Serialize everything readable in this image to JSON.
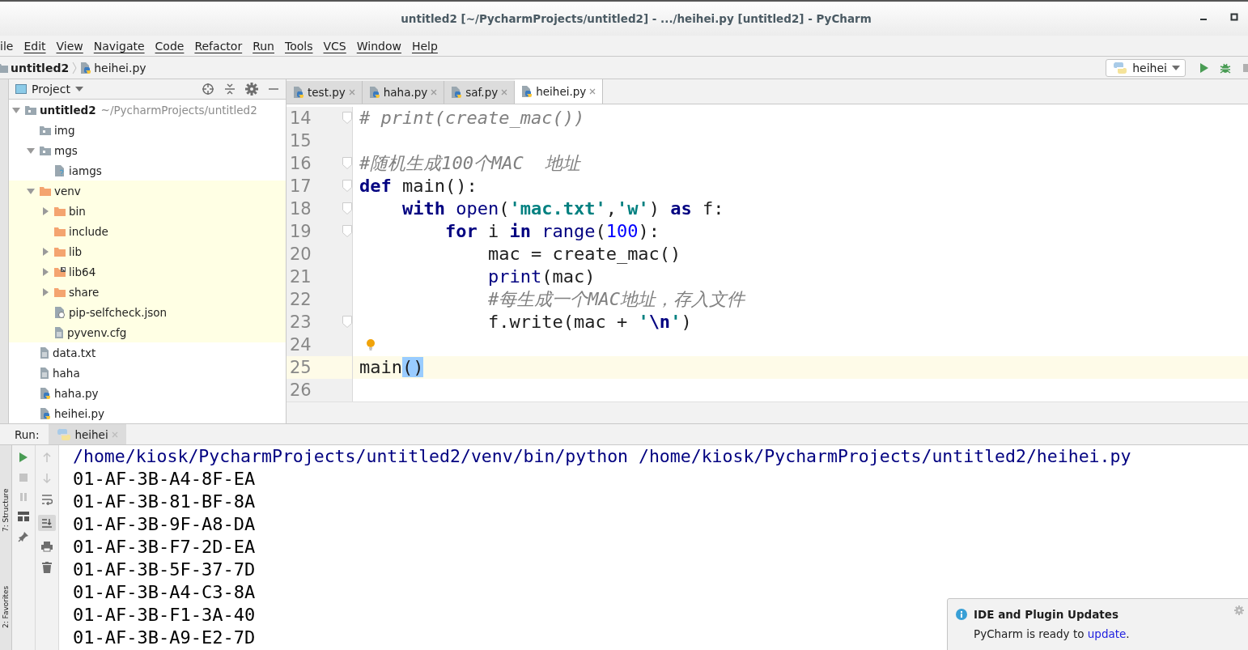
{
  "window": {
    "title": "untitled2 [~/PycharmProjects/untitled2] - .../heihei.py [untitled2] - PyCharm"
  },
  "menu": [
    "ile",
    "Edit",
    "View",
    "Navigate",
    "Code",
    "Refactor",
    "Run",
    "Tools",
    "VCS",
    "Window",
    "Help"
  ],
  "breadcrumb": [
    {
      "kind": "folder",
      "text": "untitled2"
    },
    {
      "kind": "python",
      "text": "heihei.py"
    }
  ],
  "run_config": {
    "value": "heihei"
  },
  "side_stripe": [
    "7: Structure",
    "2: Favorites"
  ],
  "project": {
    "title": "Project",
    "tree": [
      {
        "kind": "folder",
        "name": "untitled2",
        "path": "~/PycharmProjects/untitled2",
        "expanded": true,
        "children": [
          {
            "kind": "folder",
            "name": "img"
          },
          {
            "kind": "folder",
            "name": "mgs",
            "expanded": true,
            "children": [
              {
                "kind": "unknown",
                "name": "iamgs"
              }
            ]
          },
          {
            "kind": "venv",
            "name": "venv",
            "expanded": true,
            "excluded": true,
            "children": [
              {
                "kind": "venv",
                "name": "bin",
                "expanded": false,
                "excluded": true
              },
              {
                "kind": "venv",
                "name": "include",
                "excluded": true
              },
              {
                "kind": "venv",
                "name": "lib",
                "expanded": false,
                "excluded": true
              },
              {
                "kind": "link",
                "name": "lib64",
                "expanded": false,
                "excluded": true
              },
              {
                "kind": "venv",
                "name": "share",
                "expanded": false,
                "excluded": true
              },
              {
                "kind": "json",
                "name": "pip-selfcheck.json",
                "excluded": true
              },
              {
                "kind": "text",
                "name": "pyvenv.cfg",
                "excluded": true
              }
            ]
          },
          {
            "kind": "text",
            "name": "data.txt"
          },
          {
            "kind": "text",
            "name": "haha"
          },
          {
            "kind": "python",
            "name": "haha.py"
          },
          {
            "kind": "python",
            "name": "heihei.py"
          }
        ]
      }
    ]
  },
  "tabs": [
    {
      "label": "test.py",
      "selected": false
    },
    {
      "label": "haha.py",
      "selected": false
    },
    {
      "label": "saf.py",
      "selected": false
    },
    {
      "label": "heihei.py",
      "selected": true
    }
  ],
  "code": [
    {
      "number": "14",
      "fold": true,
      "tokens": [
        {
          "kind": "comment",
          "text": "# print(create_mac())"
        }
      ]
    },
    {
      "number": "15"
    },
    {
      "number": "16",
      "fold": true,
      "tokens": [
        {
          "kind": "comment",
          "text": "#随机生成100个MAC  地址"
        }
      ]
    },
    {
      "number": "17",
      "fold": true,
      "tokens": [
        {
          "kind": "keyword",
          "text": "def"
        },
        {
          "kind": "plain",
          "text": " main():"
        }
      ]
    },
    {
      "number": "18",
      "fold": true,
      "tokens": [
        {
          "kind": "keyword",
          "text": "    with"
        },
        {
          "kind": "builtin",
          "text": " open"
        },
        {
          "kind": "plain",
          "text": "("
        },
        {
          "kind": "string",
          "text": "'mac.txt'"
        },
        {
          "kind": "plain",
          "text": ","
        },
        {
          "kind": "string",
          "text": "'w'"
        },
        {
          "kind": "plain",
          "text": ") "
        },
        {
          "kind": "keyword",
          "text": "as"
        },
        {
          "kind": "plain",
          "text": " f:"
        }
      ]
    },
    {
      "number": "19",
      "fold": true,
      "tokens": [
        {
          "kind": "keyword",
          "text": "        for"
        },
        {
          "kind": "plain",
          "text": " i "
        },
        {
          "kind": "keyword",
          "text": "in"
        },
        {
          "kind": "builtin",
          "text": " range"
        },
        {
          "kind": "plain",
          "text": "("
        },
        {
          "kind": "number",
          "text": "100"
        },
        {
          "kind": "plain",
          "text": "):"
        }
      ]
    },
    {
      "number": "20",
      "tokens": [
        {
          "kind": "plain",
          "text": "            mac = create_mac()"
        }
      ]
    },
    {
      "number": "21",
      "tokens": [
        {
          "kind": "builtin",
          "text": "            print"
        },
        {
          "kind": "plain",
          "text": "(mac)"
        }
      ]
    },
    {
      "number": "22",
      "tokens": [
        {
          "kind": "comment",
          "text": "            #每生成一个MAC地址，存入文件"
        }
      ]
    },
    {
      "number": "23",
      "fold": true,
      "tokens": [
        {
          "kind": "plain",
          "text": "            f.write(mac + "
        },
        {
          "kind": "string",
          "text": "'"
        },
        {
          "kind": "escape",
          "text": "\\n"
        },
        {
          "kind": "string",
          "text": "'"
        },
        {
          "kind": "plain",
          "text": ")"
        }
      ]
    },
    {
      "number": "24",
      "bulb": true
    },
    {
      "number": "25",
      "current": true,
      "tokens": [
        {
          "kind": "plain",
          "text": "main"
        },
        {
          "kind": "match",
          "text": "()"
        }
      ]
    },
    {
      "number": "26"
    }
  ],
  "run": {
    "label": "Run:",
    "tab": "heihei",
    "output": [
      {
        "kind": "command",
        "text": "/home/kiosk/PycharmProjects/untitled2/venv/bin/python /home/kiosk/PycharmProjects/untitled2/heihei.py"
      },
      {
        "kind": "stdout",
        "text": "01-AF-3B-A4-8F-EA"
      },
      {
        "kind": "stdout",
        "text": "01-AF-3B-81-BF-8A"
      },
      {
        "kind": "stdout",
        "text": "01-AF-3B-9F-A8-DA"
      },
      {
        "kind": "stdout",
        "text": "01-AF-3B-F7-2D-EA"
      },
      {
        "kind": "stdout",
        "text": "01-AF-3B-5F-37-7D"
      },
      {
        "kind": "stdout",
        "text": "01-AF-3B-A4-C3-8A"
      },
      {
        "kind": "stdout",
        "text": "01-AF-3B-F1-3A-40"
      },
      {
        "kind": "stdout",
        "text": "01-AF-3B-A9-E2-7D"
      }
    ]
  },
  "notification": {
    "title": "IDE and Plugin Updates",
    "text": "PyCharm is ready to ",
    "link": "update",
    "after": "."
  }
}
